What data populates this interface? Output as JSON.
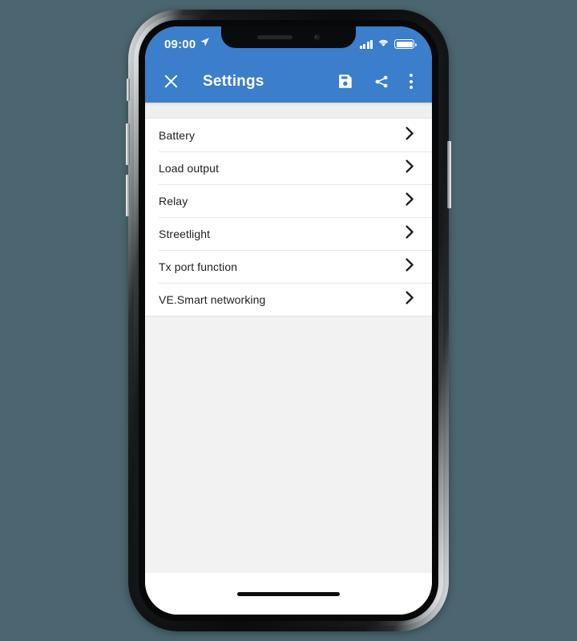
{
  "device": {
    "name": "iphone-x-mockup",
    "background_color": "#4b6670",
    "frame_color": "#0b0c0d"
  },
  "status_bar": {
    "time": "09:00",
    "location_icon": "location-arrow-icon",
    "signal_icon": "cellular-signal-icon",
    "signal_bars": 4,
    "wifi_icon": "wifi-icon",
    "battery_icon": "battery-full-icon",
    "background_color": "#3b7ecb"
  },
  "app_bar": {
    "close_icon": "close-x-icon",
    "title": "Settings",
    "save_icon": "save-floppy-icon",
    "share_icon": "share-icon",
    "overflow_icon": "overflow-menu-icon",
    "background_color": "#3b7ecb",
    "text_color": "#ffffff"
  },
  "settings_list": {
    "items": [
      {
        "label": "Battery",
        "chevron": "chevron-right-icon"
      },
      {
        "label": "Load output",
        "chevron": "chevron-right-icon"
      },
      {
        "label": "Relay",
        "chevron": "chevron-right-icon"
      },
      {
        "label": "Streetlight",
        "chevron": "chevron-right-icon"
      },
      {
        "label": "Tx port function",
        "chevron": "chevron-right-icon"
      },
      {
        "label": "VE.Smart networking",
        "chevron": "chevron-right-icon"
      }
    ]
  },
  "bottom": {
    "home_indicator": "home-indicator"
  }
}
